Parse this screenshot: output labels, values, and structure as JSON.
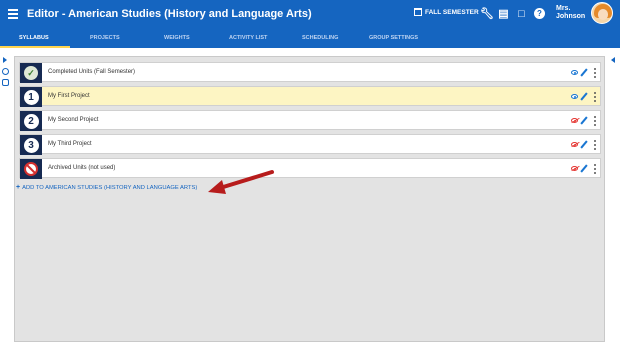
{
  "header": {
    "title": "Editor - American Studies (History and Language Arts)",
    "semester_label": "FALL SEMESTER",
    "user_line1": "Mrs.",
    "user_line2": "Johnson"
  },
  "tabs": [
    {
      "label": "SYLLABUS",
      "active": true
    },
    {
      "label": "PROJECTS"
    },
    {
      "label": "WEIGHTS"
    },
    {
      "label": "ACTIVITY LIST"
    },
    {
      "label": "SCHEDULING"
    },
    {
      "label": "GROUP SETTINGS"
    }
  ],
  "units": [
    {
      "badge": "check",
      "label": "Completed Units (Fall Semester)",
      "visible": true
    },
    {
      "badge": "1",
      "label": "My First Project",
      "visible": true,
      "highlight": true
    },
    {
      "badge": "2",
      "label": "My Second Project",
      "visible": false
    },
    {
      "badge": "3",
      "label": "My Third Project",
      "visible": false
    },
    {
      "badge": "ban",
      "label": "Archived Units (not used)",
      "visible": false
    }
  ],
  "add_link": {
    "plus": "+",
    "label": "ADD TO AMERICAN STUDIES (HISTORY AND LANGUAGE ARTS)"
  },
  "icons": {
    "menu": "hamburger-icon",
    "calendar": "calendar-icon",
    "wrench": "wrench-icon",
    "document": "document-icon",
    "clipboard": "clipboard-icon",
    "help": "help-icon",
    "visibility": "eye-icon",
    "edit": "pencil-icon",
    "more": "kebab-menu-icon"
  },
  "colors": {
    "primary": "#1565c0",
    "tab_underline": "#ffd54f",
    "highlight_row": "#fdf5c3",
    "badge_bg": "#162a52",
    "hidden_eye": "#e53935",
    "annotation_arrow": "#b71c1c"
  }
}
